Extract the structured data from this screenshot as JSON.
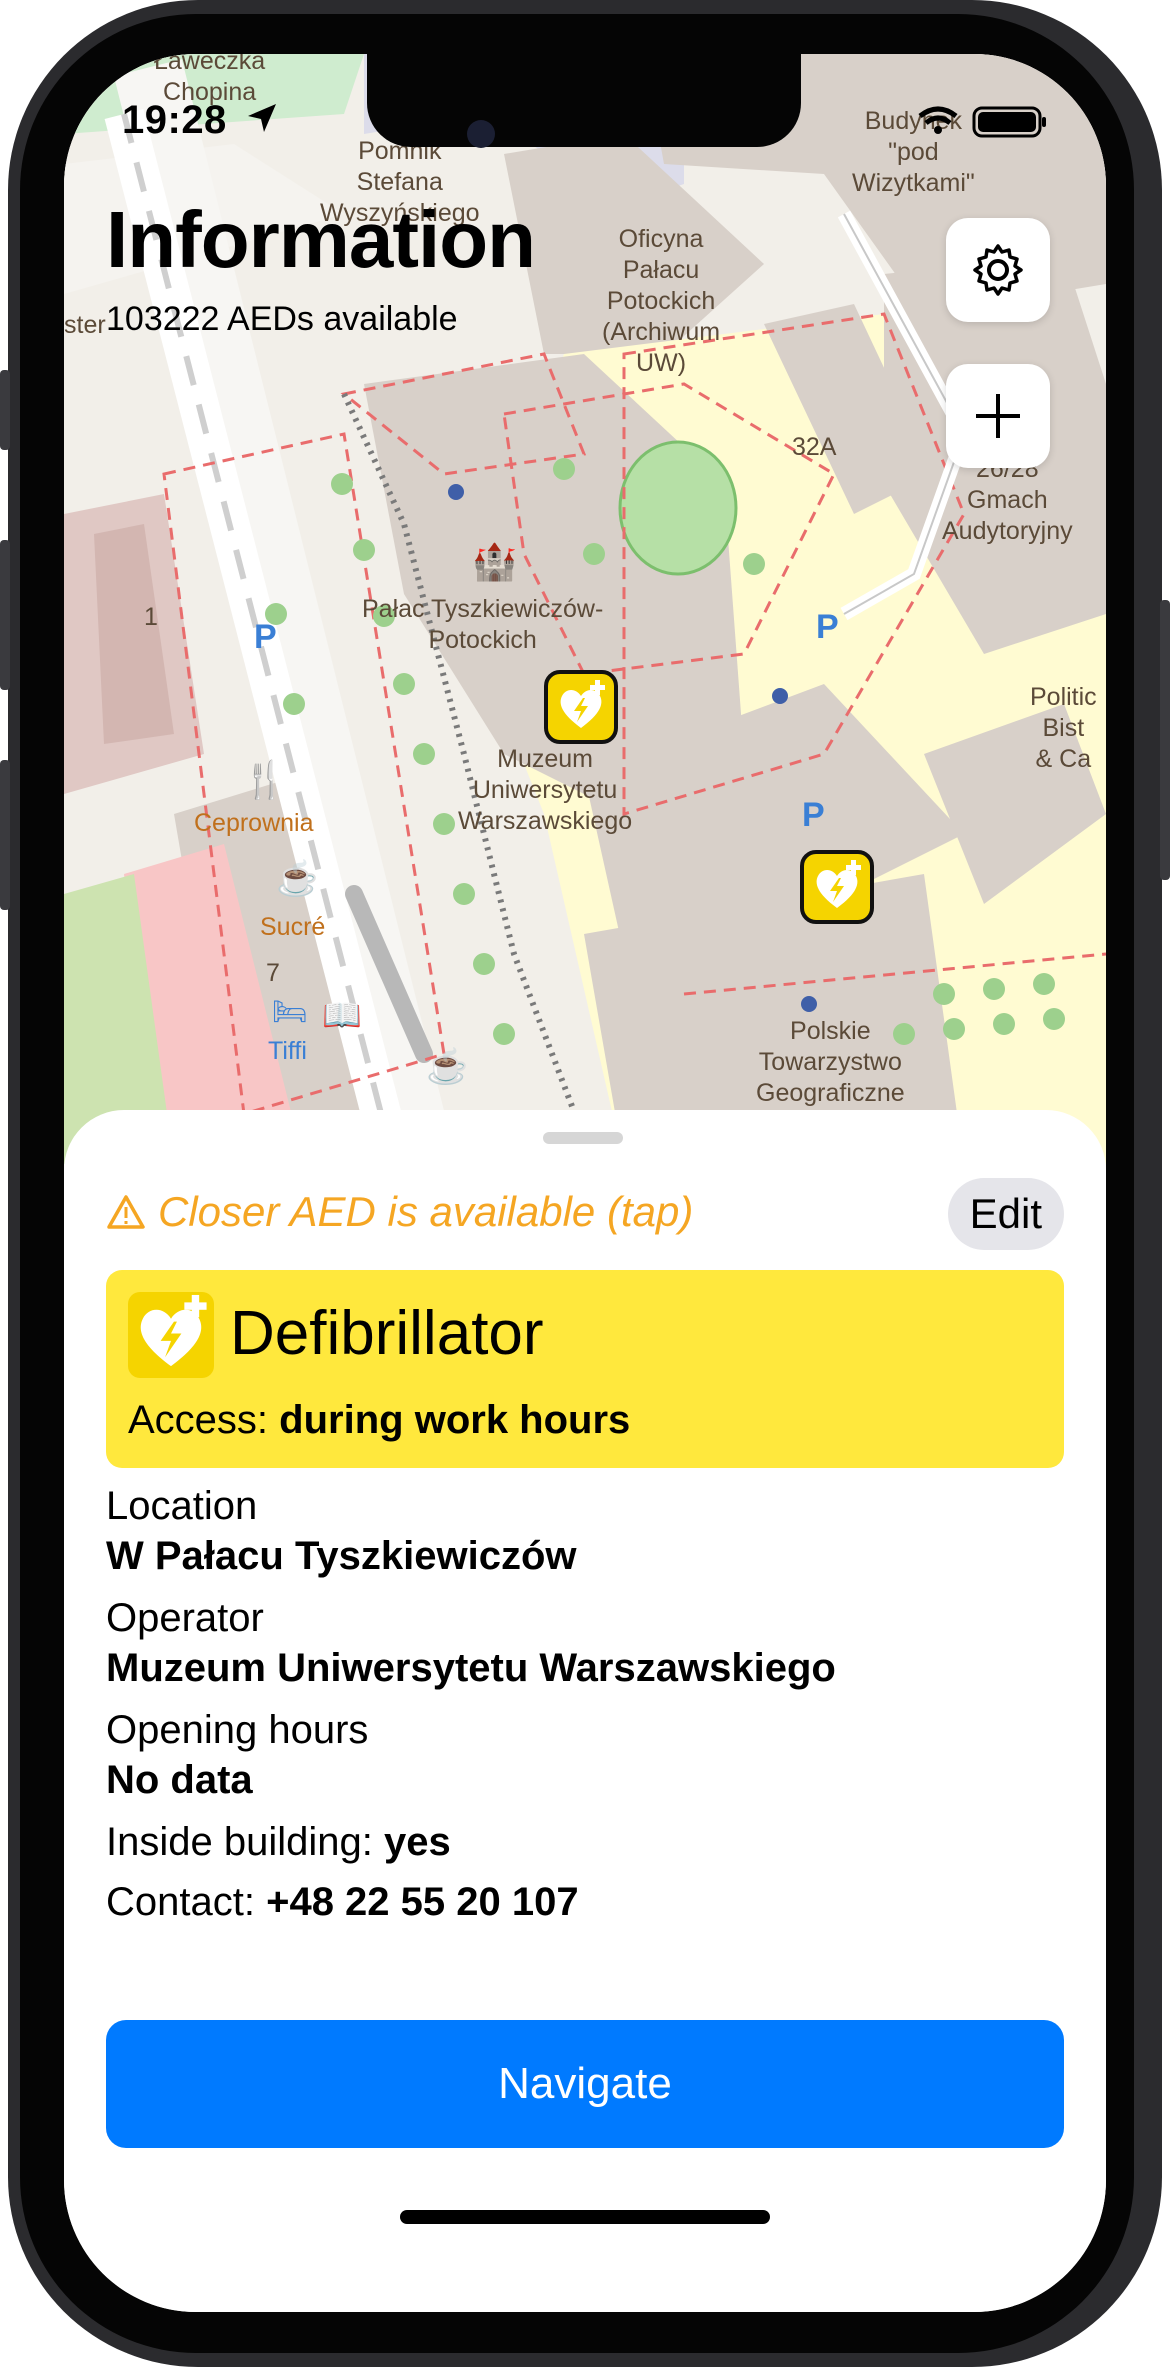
{
  "status_bar": {
    "time": "19:28"
  },
  "header": {
    "title": "Information",
    "subtitle": "103222 AEDs available"
  },
  "map": {
    "labels": {
      "laweczka": "Ławeczka\nChopina",
      "pomnik": "Pomnik\nStefana\nWyszyńskiego",
      "oficyna": "Oficyna\nPałacu\nPotockich\n(Archiwum\nUW)",
      "budynek": "Budynek\n\"pod\nWizytkami\"",
      "palac": "Pałac Tyszkiewiczów-\nPotockich",
      "muzeum": "Muzeum\nUniwersytetu\nWarszawskiego",
      "ceprownia": "Ceprownia",
      "sucre": "Sucré",
      "tiffi": "Tiffi",
      "polskie": "Polskie\nTowarzystwo\nGeograficzne",
      "gmach": "26/28\nGmach\nAudytoryjny",
      "politic": "Politic\nBist\n& Ca",
      "num_32a": "32A",
      "num_1": "1",
      "num_7": "7",
      "ster": "ster"
    }
  },
  "sheet": {
    "warning": "Closer AED is available (tap)",
    "edit_label": "Edit",
    "card_title": "Defibrillator",
    "access_label": "Access:",
    "access_value": "during work hours",
    "location_label": "Location",
    "location_value": "W Pałacu Tyszkiewiczów",
    "operator_label": "Operator",
    "operator_value": "Muzeum Uniwersytetu Warszawskiego",
    "hours_label": "Opening hours",
    "hours_value": "No data",
    "inside_label": "Inside building:",
    "inside_value": "yes",
    "contact_label": "Contact:",
    "contact_value": "+48 22 55 20 107",
    "navigate_label": "Navigate"
  },
  "icons": {
    "settings": "gear-icon",
    "add": "plus-icon",
    "aed": "aed-heart-icon",
    "warning": "warning-triangle-icon",
    "location": "location-arrow-icon"
  },
  "colors": {
    "accent": "#007aff",
    "warning": "#f5a623",
    "card": "#ffe83d",
    "aed_pin": "#f5d400"
  }
}
